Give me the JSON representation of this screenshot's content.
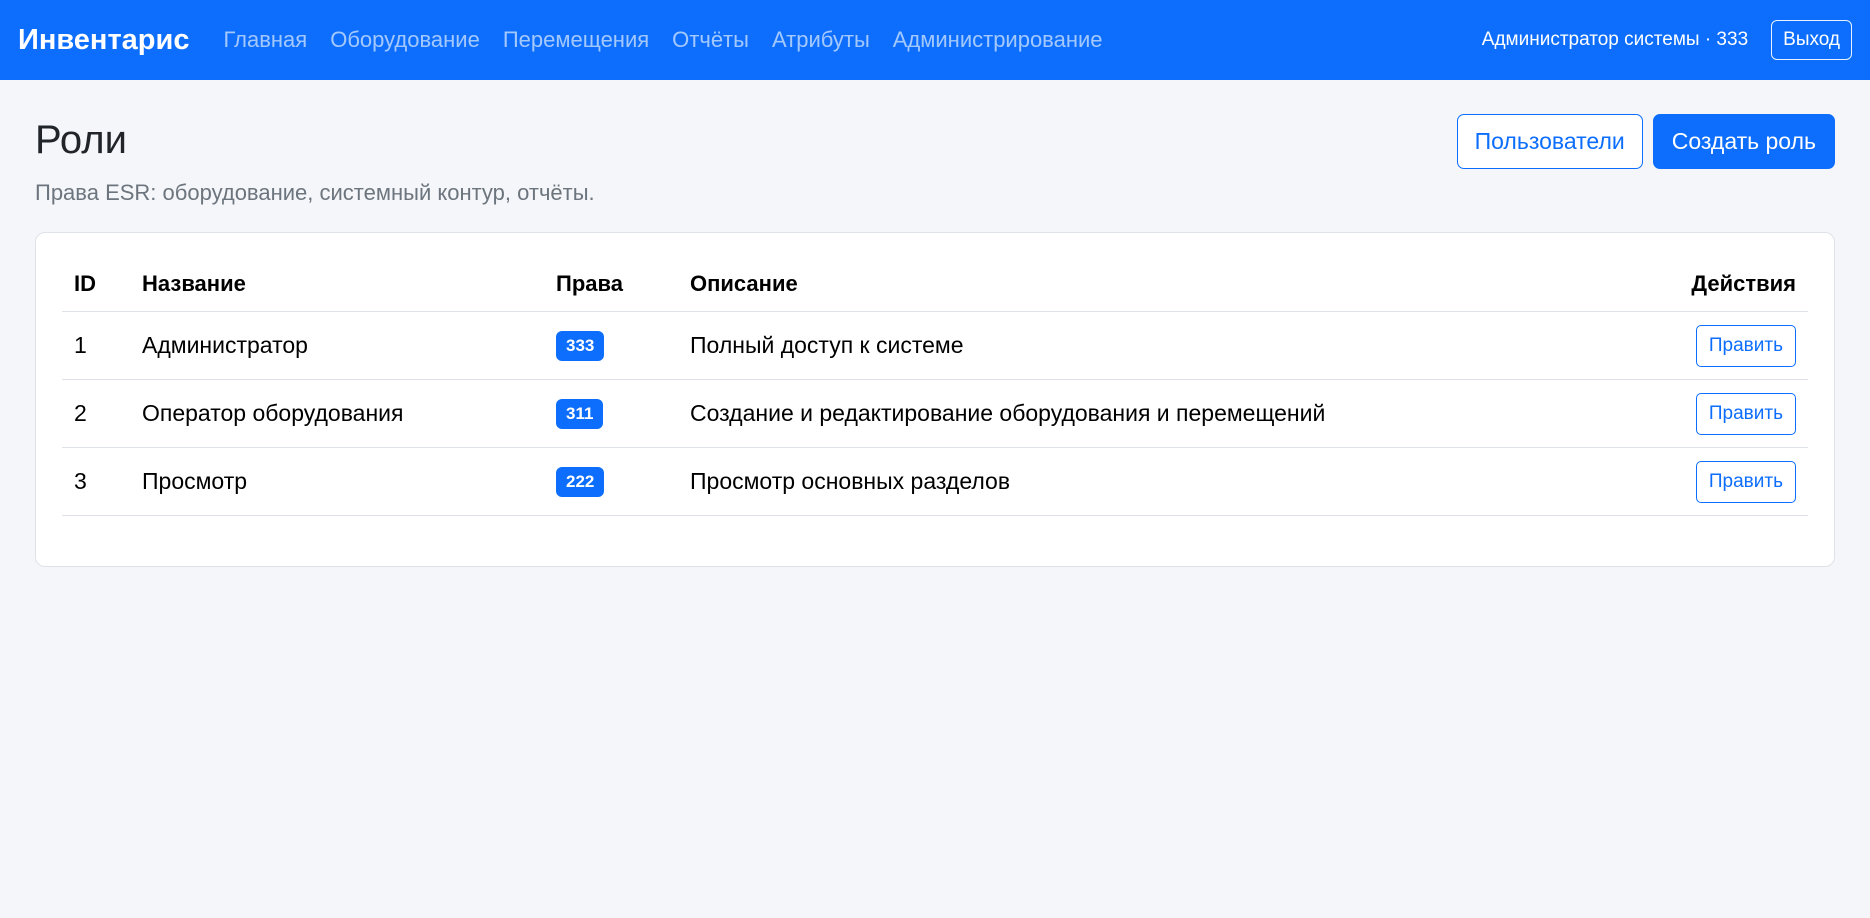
{
  "navbar": {
    "brand": "Инвентарис",
    "links": [
      "Главная",
      "Оборудование",
      "Перемещения",
      "Отчёты",
      "Атрибуты",
      "Администрирование"
    ],
    "user": "Администратор системы · 333",
    "logout": "Выход"
  },
  "page": {
    "title": "Роли",
    "subtitle": "Права ESR: оборудование, системный контур, отчёты.",
    "users_button": "Пользователи",
    "create_button": "Создать роль"
  },
  "table": {
    "headers": {
      "id": "ID",
      "name": "Название",
      "rights": "Права",
      "description": "Описание",
      "actions": "Действия"
    },
    "rows": [
      {
        "id": "1",
        "name": "Администратор",
        "rights": "333",
        "description": "Полный доступ к системе",
        "action": "Править"
      },
      {
        "id": "2",
        "name": "Оператор оборудования",
        "rights": "311",
        "description": "Создание и редактирование оборудования и перемещений",
        "action": "Править"
      },
      {
        "id": "3",
        "name": "Просмотр",
        "rights": "222",
        "description": "Просмотр основных разделов",
        "action": "Править"
      }
    ]
  },
  "colors": {
    "primary": "#0d6efd",
    "background": "#f5f6fa"
  }
}
